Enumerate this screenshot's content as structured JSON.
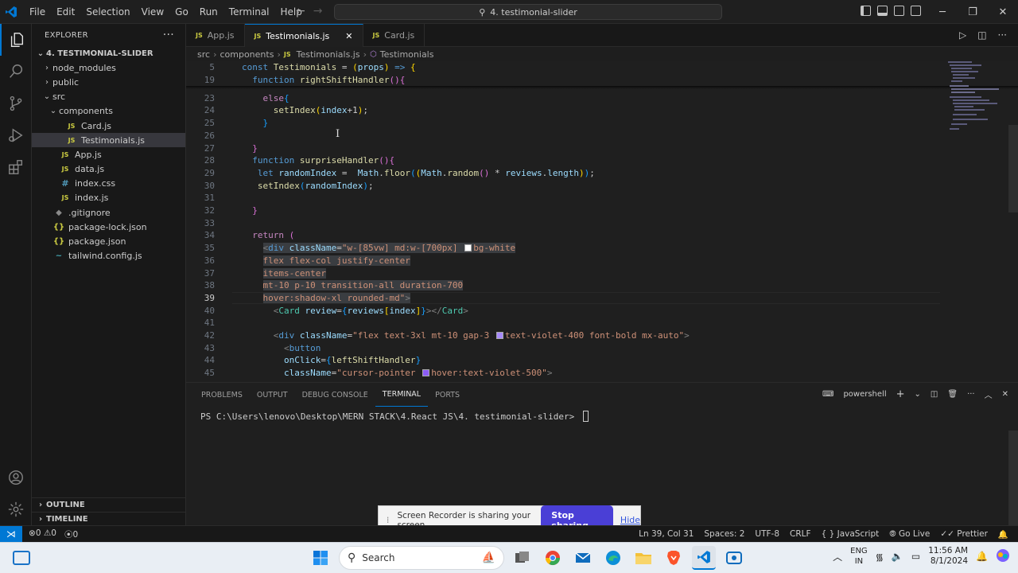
{
  "titlebar": {
    "menu": [
      "File",
      "Edit",
      "Selection",
      "View",
      "Go",
      "Run",
      "Terminal",
      "Help"
    ],
    "search_text": "4. testimonial-slider"
  },
  "sidebar": {
    "title": "EXPLORER",
    "more": "···",
    "root": "4. TESTIMONIAL-SLIDER",
    "items": [
      {
        "label": "node_modules",
        "depth": 1,
        "chev": "›",
        "icon": ""
      },
      {
        "label": "public",
        "depth": 1,
        "chev": "›",
        "icon": ""
      },
      {
        "label": "src",
        "depth": 1,
        "chev": "⌄",
        "icon": ""
      },
      {
        "label": "components",
        "depth": 2,
        "chev": "⌄",
        "icon": ""
      },
      {
        "label": "Card.js",
        "depth": 3,
        "chev": "",
        "icon": "JS"
      },
      {
        "label": "Testimonials.js",
        "depth": 3,
        "chev": "",
        "icon": "JS",
        "selected": true
      },
      {
        "label": "App.js",
        "depth": 2,
        "chev": "",
        "icon": "JS"
      },
      {
        "label": "data.js",
        "depth": 2,
        "chev": "",
        "icon": "JS"
      },
      {
        "label": "index.css",
        "depth": 2,
        "chev": "",
        "icon": "#"
      },
      {
        "label": "index.js",
        "depth": 2,
        "chev": "",
        "icon": "JS"
      },
      {
        "label": ".gitignore",
        "depth": 1,
        "chev": "",
        "icon": "◆"
      },
      {
        "label": "package-lock.json",
        "depth": 1,
        "chev": "",
        "icon": "{}"
      },
      {
        "label": "package.json",
        "depth": 1,
        "chev": "",
        "icon": "{}"
      },
      {
        "label": "tailwind.config.js",
        "depth": 1,
        "chev": "",
        "icon": "~"
      }
    ],
    "outline": "OUTLINE",
    "timeline": "TIMELINE"
  },
  "tabs": [
    {
      "label": "App.js",
      "active": false
    },
    {
      "label": "Testimonials.js",
      "active": true
    },
    {
      "label": "Card.js",
      "active": false
    }
  ],
  "breadcrumb": {
    "parts": [
      "src",
      "components",
      "Testimonials.js",
      "Testimonials"
    ]
  },
  "editor": {
    "current_line": 39,
    "lines": [
      {
        "n": "5",
        "html": "<span class='kw'>const</span> <span class='fn'>Testimonials</span> = <span class='br1'>(</span><span class='var'>props</span><span class='br1'>)</span> <span class='kw'>=&gt;</span> <span class='br1'>{</span>",
        "indent": 0
      },
      {
        "n": "19",
        "html": "  <span class='kw'>function</span> <span class='fn'>rightShiftHandler</span><span class='br2'>()</span><span class='br2'>{</span>",
        "indent": 0
      },
      {
        "n": "23",
        "html": "    <span class='ctl'>else</span><span class='br3'>{</span>",
        "indent": 0
      },
      {
        "n": "24",
        "html": "      <span class='fn'>setIndex</span><span class='br1'>(</span><span class='var'>index</span>+<span class='num'>1</span><span class='br1'>)</span>;",
        "indent": 0
      },
      {
        "n": "25",
        "html": "    <span class='br3'>}</span>",
        "indent": 0
      },
      {
        "n": "26",
        "html": "",
        "indent": 0
      },
      {
        "n": "27",
        "html": "  <span class='br2'>}</span>",
        "indent": 0
      },
      {
        "n": "28",
        "html": "  <span class='kw'>function</span> <span class='fn'>surpriseHandler</span><span class='br2'>()</span><span class='br2'>{</span>",
        "indent": 0
      },
      {
        "n": "29",
        "html": "   <span class='kw'>let</span> <span class='var'>randomIndex</span> =  <span class='var'>Math</span>.<span class='fn'>floor</span><span class='br3'>(</span><span class='br1'>(</span><span class='var'>Math</span>.<span class='fn'>random</span><span class='br2'>()</span> * <span class='var'>reviews</span>.<span class='var'>length</span><span class='br1'>)</span><span class='br3'>)</span>;",
        "indent": 0
      },
      {
        "n": "30",
        "html": "   <span class='fn'>setIndex</span><span class='br3'>(</span><span class='var'>randomIndex</span><span class='br3'>)</span>;",
        "indent": 0
      },
      {
        "n": "31",
        "html": "",
        "indent": 0
      },
      {
        "n": "32",
        "html": "  <span class='br2'>}</span>",
        "indent": 0
      },
      {
        "n": "33",
        "html": "",
        "indent": 0
      },
      {
        "n": "34",
        "html": "  <span class='ctl'>return</span> <span class='br2'>(</span>",
        "indent": 0
      },
      {
        "n": "35",
        "html": "    <span class='sel'><span class='punc'>&lt;</span><span class='tag'>div</span> <span class='var'>className</span>=<span class='str'>\"w-[85vw] md:w-[700px] <span class='swatch' style='background:#ffffff'></span>bg-white</span></span>",
        "indent": 0
      },
      {
        "n": "36",
        "html": "    <span class='sel str'>flex flex-col justify-center</span>",
        "indent": 0
      },
      {
        "n": "37",
        "html": "    <span class='sel str'>items-center</span>",
        "indent": 0
      },
      {
        "n": "38",
        "html": "    <span class='sel str'>mt-10 p-10 transition-all duration-700</span>",
        "indent": 0
      },
      {
        "n": "39",
        "html": "    <span class='sel'><span class='str'>hover:shadow-xl rounded-md\"</span><span class='punc'>&gt;</span></span>",
        "indent": 0
      },
      {
        "n": "40",
        "html": "      <span class='punc'>&lt;</span><span class='comp'>Card</span> <span class='var'>review</span>=<span class='br3'>{</span><span class='var'>reviews</span><span class='br1'>[</span><span class='var'>index</span><span class='br1'>]</span><span class='br3'>}</span><span class='punc'>&gt;&lt;/</span><span class='comp'>Card</span><span class='punc'>&gt;</span>",
        "indent": 0
      },
      {
        "n": "41",
        "html": "",
        "indent": 0
      },
      {
        "n": "42",
        "html": "      <span class='punc'>&lt;</span><span class='tag'>div</span> <span class='var'>className</span>=<span class='str'>\"flex text-3xl mt-10 gap-3 <span class='swatch' style='background:#a78bfa'></span>text-violet-400 font-bold mx-auto\"</span><span class='punc'>&gt;</span>",
        "indent": 0
      },
      {
        "n": "43",
        "html": "        <span class='punc'>&lt;</span><span class='tag'>button</span>",
        "indent": 0
      },
      {
        "n": "44",
        "html": "        <span class='var'>onClick</span>=<span class='br3'>{</span><span class='fn'>leftShiftHandler</span><span class='br3'>}</span>",
        "indent": 0
      },
      {
        "n": "45",
        "html": "        <span class='var'>className</span>=<span class='str'>\"cursor-pointer <span class='swatch' style='background:#8b5cf6'></span>hover:text-violet-500\"</span><span class='punc'>&gt;</span>",
        "indent": 0
      }
    ]
  },
  "panel": {
    "tabs": [
      "PROBLEMS",
      "OUTPUT",
      "DEBUG CONSOLE",
      "TERMINAL",
      "PORTS"
    ],
    "active_tab": "TERMINAL",
    "shell": "powershell",
    "prompt": "PS C:\\Users\\lenovo\\Desktop\\MERN STACK\\4.React JS\\4. testimonial-slider> "
  },
  "sharebar": {
    "message": "Screen Recorder is sharing your screen.",
    "stop_label": "Stop sharing",
    "hide_label": "Hide"
  },
  "statusbar": {
    "errors": "0",
    "warnings": "0",
    "ports": "0",
    "position": "Ln 39, Col 31",
    "spaces": "Spaces: 2",
    "encoding": "UTF-8",
    "eol": "CRLF",
    "language": "JavaScript",
    "golive": "Go Live",
    "prettier": "Prettier"
  },
  "taskbar": {
    "search_placeholder": "Search",
    "lang_top": "ENG",
    "lang_bottom": "IN",
    "time": "11:56 AM",
    "date": "8/1/2024"
  },
  "colors": {
    "accent": "#0078d4",
    "stop_button": "#4a3fd6"
  }
}
